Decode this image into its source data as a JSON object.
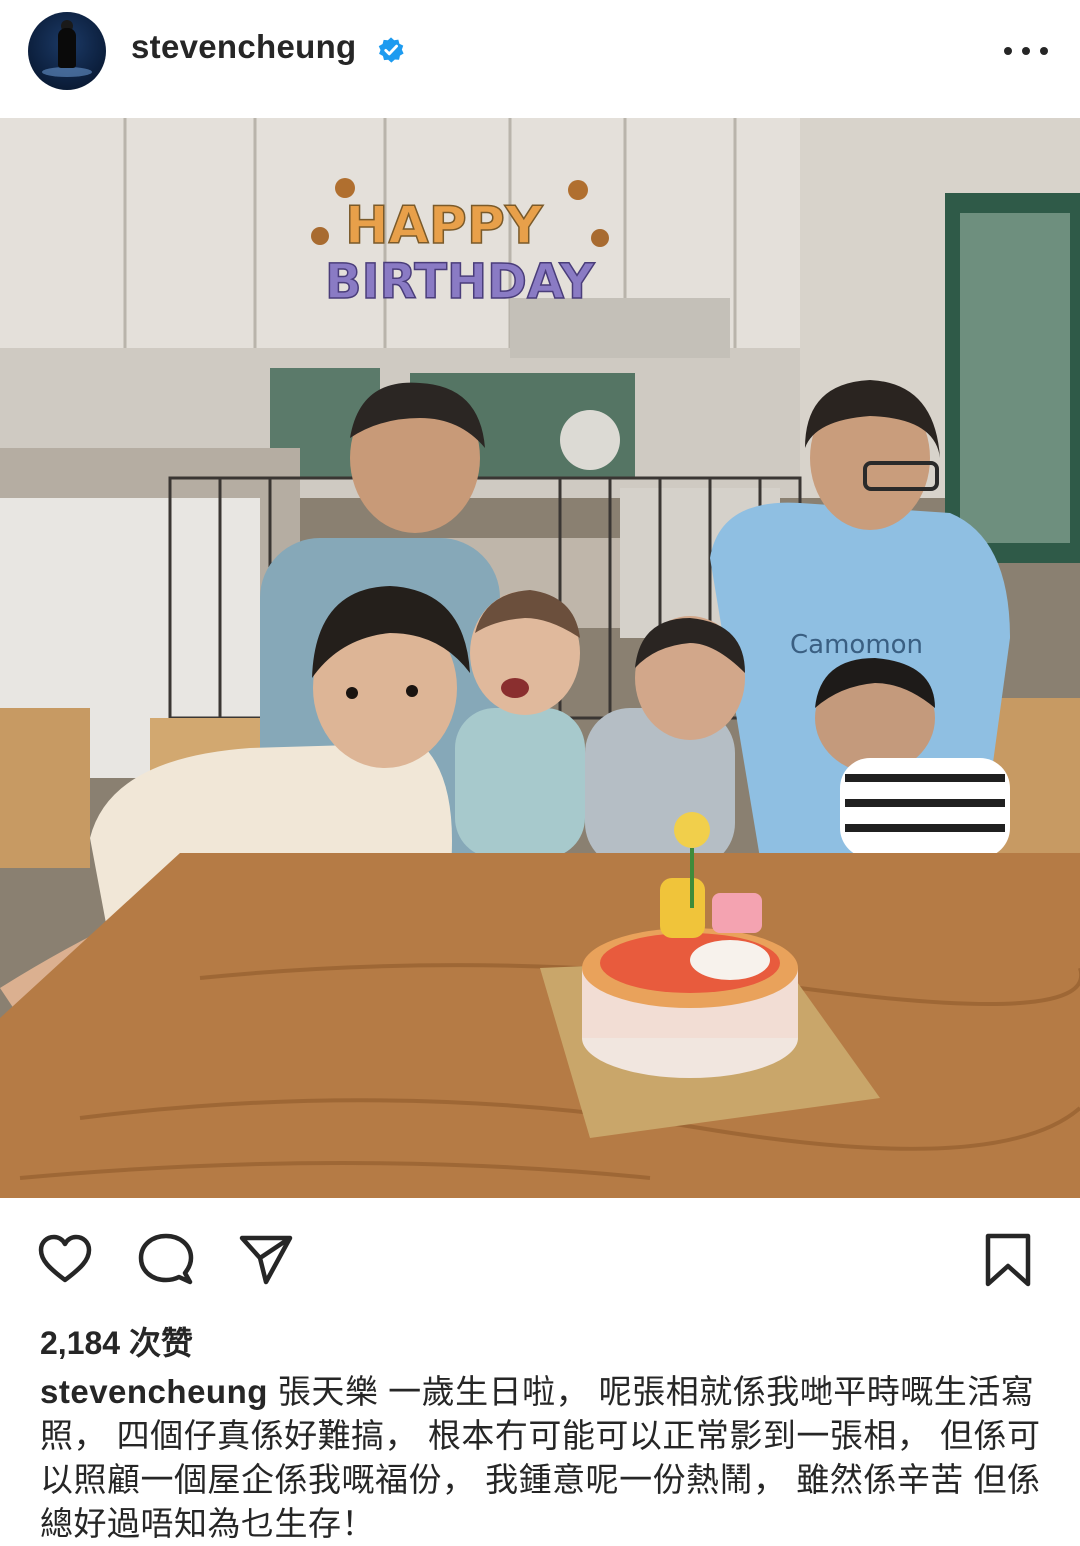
{
  "header": {
    "username": "stevencheung",
    "verified_icon": "verified-badge-icon",
    "more_icon": "more-options-icon"
  },
  "photo": {
    "banner_line1": "HAPPY",
    "banner_line2": "BIRTHDAY"
  },
  "actions": {
    "like_icon": "heart-icon",
    "comment_icon": "comment-icon",
    "share_icon": "send-icon",
    "save_icon": "bookmark-icon"
  },
  "post": {
    "likes": "2,184 次赞",
    "caption_user": "stevencheung",
    "caption_text": "張天樂 一歲生日啦， 呢張相就係我哋平時嘅生活寫照， 四個仔真係好難搞， 根本冇可能可以正常影到一張相， 但係可以照顧一個屋企係我嘅福份， 我鍾意呢一份熱鬧， 雖然係辛苦 但係總好過唔知為乜生存！"
  },
  "colors": {
    "verified_blue": "#1d9bf0",
    "text": "#262626"
  }
}
